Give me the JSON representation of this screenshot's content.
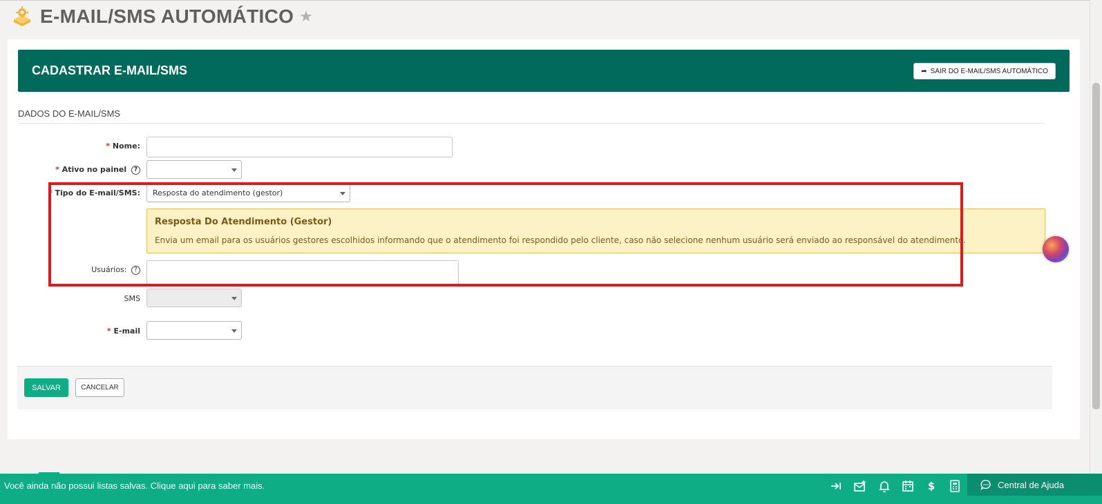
{
  "header": {
    "title": "E-MAIL/SMS AUTOMÁTICO"
  },
  "banner": {
    "title": "CADASTRAR E-MAIL/SMS",
    "exit_label": "SAIR DO E-MAIL/SMS AUTOMÁTICO"
  },
  "section": {
    "title": "DADOS DO E-MAIL/SMS"
  },
  "form": {
    "nome_label": "Nome:",
    "ativo_label": "Ativo no painel",
    "tipo_label": "Tipo do E-mail/SMS:",
    "tipo_value": "Resposta do atendimento (gestor)",
    "usuarios_label": "Usuários:",
    "sms_label": "SMS",
    "email_label": "E-mail",
    "required_mark": "*",
    "help_mark": "?"
  },
  "alert": {
    "title": "Resposta Do Atendimento (Gestor)",
    "text": "Envia um email para os usuários gestores escolhidos informando que o atendimento foi respondido pelo cliente, caso não selecione nenhum usuário será enviado ao responsável do atendimento."
  },
  "actions": {
    "save_label": "SALVAR",
    "cancel_label": "CANCELAR"
  },
  "bottombar": {
    "message": "Você ainda não possui listas salvas. Clique aqui para saber mais.",
    "help_center_label": "Central de Ajuda",
    "dollar_glyph": "$"
  },
  "colors": {
    "banner": "#016a5b",
    "accent": "#0fad86",
    "highlight": "#e6161b",
    "alert_bg": "#fdf1c6"
  }
}
